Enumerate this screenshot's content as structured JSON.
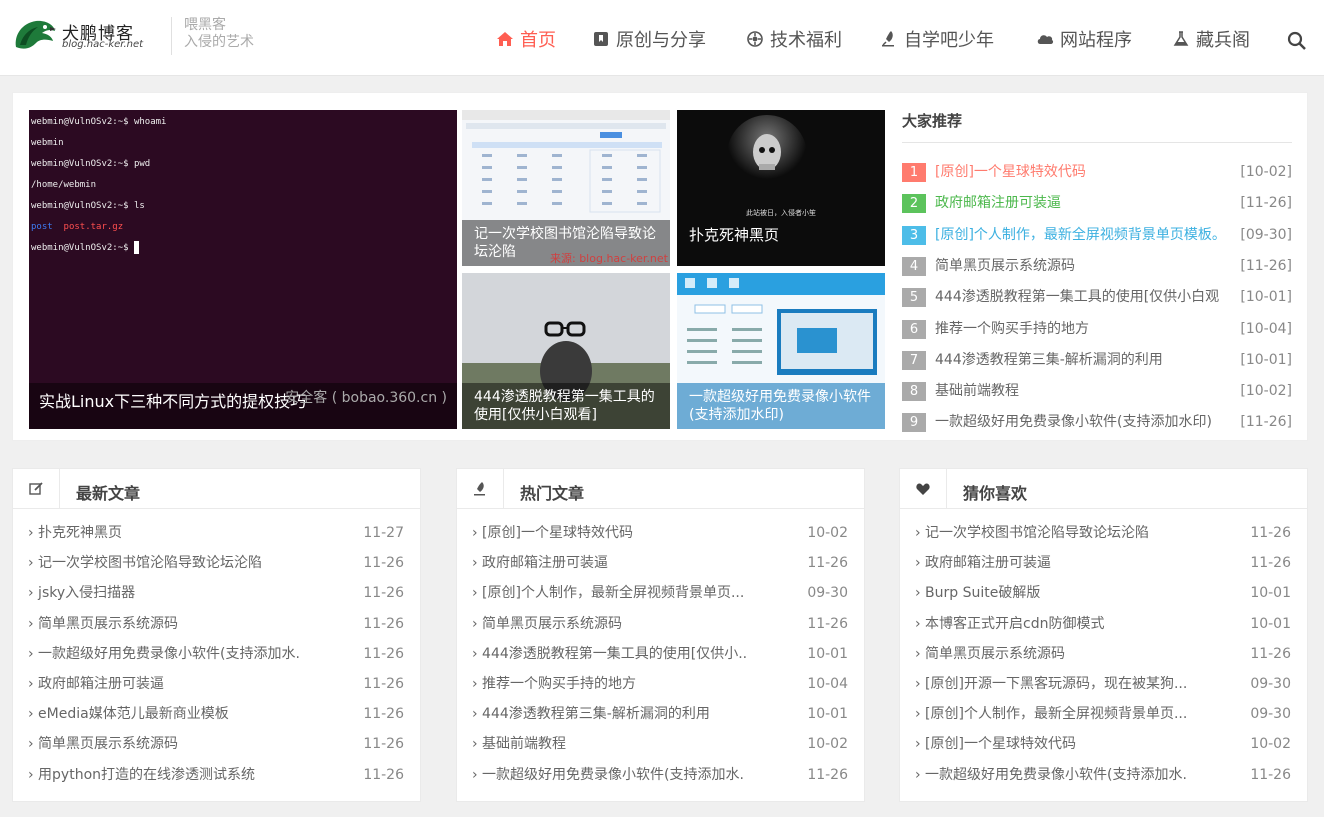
{
  "header": {
    "logo_cn": "犬鹏博客",
    "logo_en": "blog.hac-ker.net",
    "slogan_line1": "喂黑客",
    "slogan_line2": "入侵的艺术",
    "nav": [
      {
        "label": "首页",
        "icon": "home-icon"
      },
      {
        "label": "原创与分享",
        "icon": "bookmark-icon"
      },
      {
        "label": "技术福利",
        "icon": "gear-icon"
      },
      {
        "label": "自学吧少年",
        "icon": "rocket-icon"
      },
      {
        "label": "网站程序",
        "icon": "cloud-icon"
      },
      {
        "label": "藏兵阁",
        "icon": "flask-icon"
      }
    ],
    "accent_color": "#ff5e52"
  },
  "featured": {
    "main_caption": "实战Linux下三种不同方式的提权技巧",
    "main_watermark": "安全客 ( bobao.360.cn )",
    "terminal_lines": [
      "webmin@VulnOSv2:~$ whoami",
      "webmin",
      "webmin@VulnOSv2:~$ pwd",
      "/home/webmin",
      "webmin@VulnOSv2:~$ ls"
    ],
    "terminal_ls_1": "post",
    "terminal_ls_2": "post.tar.gz",
    "terminal_prompt": "webmin@VulnOSv2:~$",
    "tile1_caption": "记一次学校图书馆沦陷导致论坛沦陷",
    "tile1_watermark": "来源: blog.hac-ker.net",
    "tile2_caption": "扑克死神黑页",
    "tile2_text": "此站被日，入侵者小笙",
    "tile3_caption": "444渗透脱教程第一集工具的使用[仅供小白观看]",
    "tile4_caption": "一款超级好用免费录像小软件(支持添加水印)"
  },
  "recommend": {
    "title": "大家推荐",
    "items": [
      {
        "num": "1",
        "text": "[原创]一个星球特效代码",
        "date": "[10-02]",
        "color": "#ff7b6e",
        "textColor": "#ff7b6e"
      },
      {
        "num": "2",
        "text": "政府邮箱注册可装逼",
        "date": "[11-26]",
        "color": "#5cc35c",
        "textColor": "#4cb84c"
      },
      {
        "num": "3",
        "text": "[原创]个人制作，最新全屏视频背景单页模板。",
        "date": "[09-30]",
        "color": "#4dbde8",
        "textColor": "#3cb0e0"
      },
      {
        "num": "4",
        "text": "简单黑页展示系统源码",
        "date": "[11-26]",
        "color": "#aaaaaa",
        "textColor": "#666666"
      },
      {
        "num": "5",
        "text": "444渗透脱教程第一集工具的使用[仅供小白观",
        "date": "[10-01]",
        "color": "#aaaaaa",
        "textColor": "#666666"
      },
      {
        "num": "6",
        "text": "推荐一个购买手持的地方",
        "date": "[10-04]",
        "color": "#aaaaaa",
        "textColor": "#666666"
      },
      {
        "num": "7",
        "text": "444渗透教程第三集-解析漏洞的利用",
        "date": "[10-01]",
        "color": "#aaaaaa",
        "textColor": "#666666"
      },
      {
        "num": "8",
        "text": "基础前端教程",
        "date": "[10-02]",
        "color": "#aaaaaa",
        "textColor": "#666666"
      },
      {
        "num": "9",
        "text": "一款超级好用免费录像小软件(支持添加水印)",
        "date": "[11-26]",
        "color": "#aaaaaa",
        "textColor": "#666666"
      }
    ]
  },
  "panels": [
    {
      "title": "最新文章",
      "icon": "edit-icon",
      "items": [
        {
          "text": "› 扑克死神黑页",
          "date": "11-27"
        },
        {
          "text": "› 记一次学校图书馆沦陷导致论坛沦陷",
          "date": "11-26"
        },
        {
          "text": "› jsky入侵扫描器",
          "date": "11-26"
        },
        {
          "text": "› 简单黑页展示系统源码",
          "date": "11-26"
        },
        {
          "text": "› 一款超级好用免费录像小软件(支持添加水.",
          "date": "11-26"
        },
        {
          "text": "› 政府邮箱注册可装逼",
          "date": "11-26"
        },
        {
          "text": "› eMedia媒体范儿最新商业模板",
          "date": "11-26"
        },
        {
          "text": "› 简单黑页展示系统源码",
          "date": "11-26"
        },
        {
          "text": "› 用python打造的在线渗透测试系统",
          "date": "11-26"
        }
      ]
    },
    {
      "title": "热门文章",
      "icon": "rocket-icon",
      "items": [
        {
          "text": "› [原创]一个星球特效代码",
          "date": "10-02"
        },
        {
          "text": "› 政府邮箱注册可装逼",
          "date": "11-26"
        },
        {
          "text": "› [原创]个人制作，最新全屏视频背景单页...",
          "date": "09-30"
        },
        {
          "text": "› 简单黑页展示系统源码",
          "date": "11-26"
        },
        {
          "text": "› 444渗透脱教程第一集工具的使用[仅供小..",
          "date": "10-01"
        },
        {
          "text": "› 推荐一个购买手持的地方",
          "date": "10-04"
        },
        {
          "text": "› 444渗透教程第三集-解析漏洞的利用",
          "date": "10-01"
        },
        {
          "text": "› 基础前端教程",
          "date": "10-02"
        },
        {
          "text": "› 一款超级好用免费录像小软件(支持添加水.",
          "date": "11-26"
        }
      ]
    },
    {
      "title": "猜你喜欢",
      "icon": "heart-icon",
      "items": [
        {
          "text": "› 记一次学校图书馆沦陷导致论坛沦陷",
          "date": "11-26"
        },
        {
          "text": "› 政府邮箱注册可装逼",
          "date": "11-26"
        },
        {
          "text": "› Burp Suite破解版",
          "date": "10-01"
        },
        {
          "text": "› 本博客正式开启cdn防御模式",
          "date": "10-01"
        },
        {
          "text": "› 简单黑页展示系统源码",
          "date": "11-26"
        },
        {
          "text": "› [原创]开源一下黑客玩源码，现在被某狗...",
          "date": "09-30"
        },
        {
          "text": "› [原创]个人制作，最新全屏视频背景单页...",
          "date": "09-30"
        },
        {
          "text": "› [原创]一个星球特效代码",
          "date": "10-02"
        },
        {
          "text": "› 一款超级好用免费录像小软件(支持添加水.",
          "date": "11-26"
        }
      ]
    }
  ]
}
